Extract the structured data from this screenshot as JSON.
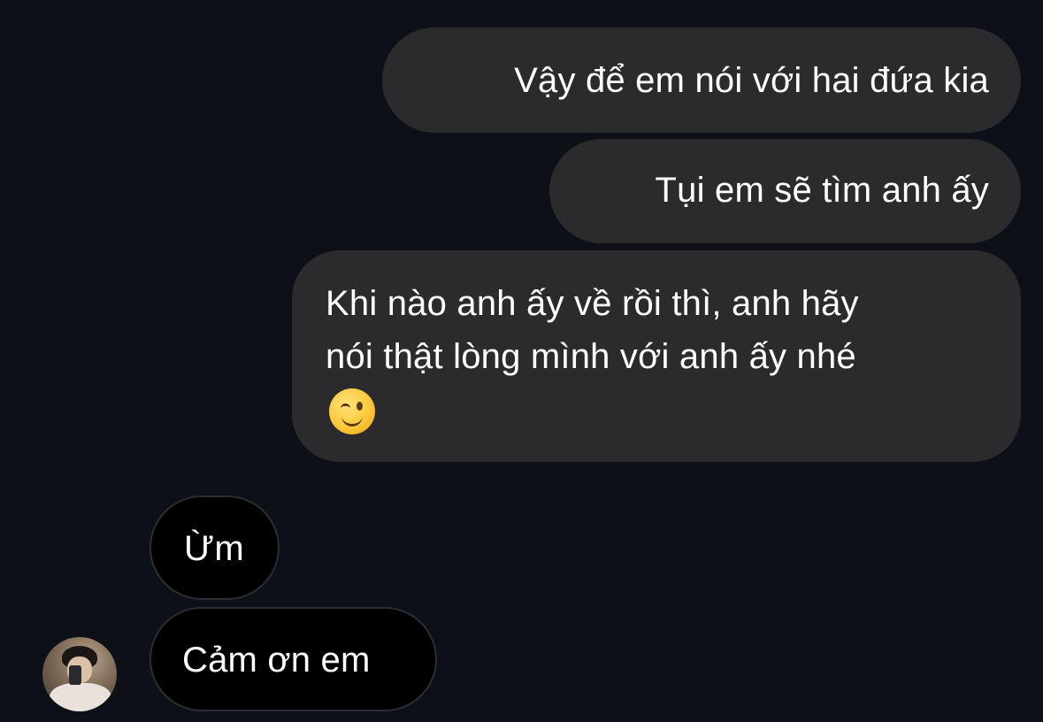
{
  "conversation": {
    "outgoing": [
      {
        "lines": [
          "Vậy để em nói với hai đứa kia"
        ]
      },
      {
        "lines": [
          "Tụi em sẽ tìm anh ấy"
        ]
      },
      {
        "lines": [
          "Khi nào anh ấy về rồi thì, anh hãy",
          "nói thật lòng mình với anh ấy nhé"
        ],
        "emoji": "winking-face-emoji"
      }
    ],
    "incoming": [
      {
        "lines": [
          "Ừm"
        ]
      },
      {
        "lines": [
          "Cảm ơn em"
        ]
      }
    ],
    "avatar_icon": "contact-avatar-photo"
  },
  "colors": {
    "background": "#0d1016",
    "outgoing_bubble": "#2b2b2d",
    "incoming_bubble": "#000000",
    "incoming_border": "#2b2d33",
    "text": "#ffffff"
  }
}
